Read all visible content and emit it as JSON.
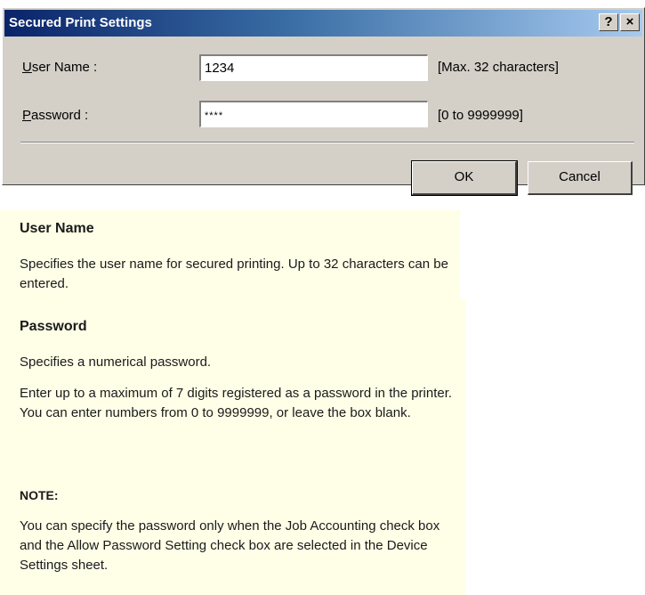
{
  "dialog": {
    "title": "Secured Print Settings",
    "help_button": "?",
    "close_button": "×",
    "user_name": {
      "label_mnemonic": "U",
      "label_rest": "ser Name :",
      "value": "1234",
      "hint": "[Max. 32 characters]"
    },
    "password": {
      "label_mnemonic": "P",
      "label_rest": "assword :",
      "value": "****",
      "hint": "[0 to 9999999]"
    },
    "ok_label": "OK",
    "cancel_label": "Cancel"
  },
  "help": {
    "user_name_heading": "User Name",
    "user_name_text": "Specifies the user name for secured printing. Up to 32 characters can be entered.",
    "password_heading": "Password",
    "password_text_1": "Specifies a numerical password.",
    "password_text_2": "Enter up to a maximum of 7 digits registered as a password in the printer. You can enter numbers from 0 to 9999999, or leave the box blank.",
    "note_heading": "NOTE:",
    "note_text": "You can specify the password only when the Job Accounting check box and the Allow Password Setting check box are selected in the Device Settings sheet."
  }
}
